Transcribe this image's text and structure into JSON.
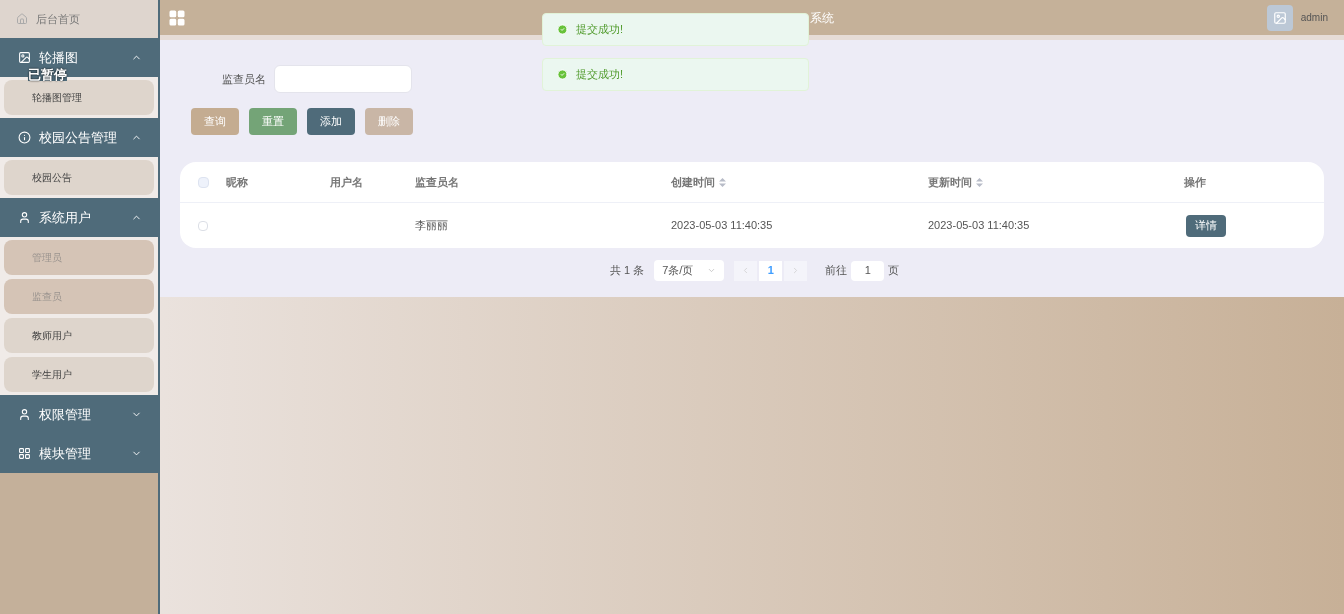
{
  "sidebar": {
    "home": "后台首页",
    "overlay_label": "已暂停",
    "groups": [
      {
        "label": "轮播图",
        "expanded": true,
        "items": [
          {
            "label": "轮播图管理",
            "selected": false
          }
        ]
      },
      {
        "label": "校园公告管理",
        "expanded": true,
        "items": [
          {
            "label": "校园公告",
            "selected": false
          }
        ]
      },
      {
        "label": "系统用户",
        "expanded": true,
        "items": [
          {
            "label": "管理员",
            "selected": true
          },
          {
            "label": "监查员",
            "selected": true
          },
          {
            "label": "教师用户",
            "selected": false
          },
          {
            "label": "学生用户",
            "selected": false
          }
        ]
      },
      {
        "label": "权限管理",
        "expanded": false
      },
      {
        "label": "模块管理",
        "expanded": false
      }
    ]
  },
  "header": {
    "title": "系统",
    "user": "admin"
  },
  "toasts": [
    "提交成功!",
    "提交成功!"
  ],
  "search": {
    "label": "监查员名"
  },
  "buttons": [
    {
      "label": "查询",
      "kind": "query"
    },
    {
      "label": "重置",
      "kind": "reset"
    },
    {
      "label": "添加",
      "kind": "add"
    },
    {
      "label": "删除",
      "kind": "delete"
    }
  ],
  "table": {
    "all_checked": false,
    "columns": [
      {
        "label": "昵称",
        "sortable": false
      },
      {
        "label": "用户名",
        "sortable": false
      },
      {
        "label": "监查员名",
        "sortable": false
      },
      {
        "label": "创建时间",
        "sortable": true
      },
      {
        "label": "更新时间",
        "sortable": true
      },
      {
        "label": "操作",
        "sortable": false
      }
    ],
    "rows": [
      {
        "checked": false,
        "cells": [
          "",
          "",
          "李丽丽",
          "2023-05-03 11:40:35",
          "2023-05-03 11:40:35"
        ],
        "action": "详情"
      }
    ]
  },
  "pagination": {
    "total": "共 1 条",
    "page_size": "7条/页",
    "pages": [
      {
        "label": "1",
        "selected": true
      }
    ],
    "goto_label": "前往",
    "goto_value": "1",
    "page_suffix": "页"
  }
}
